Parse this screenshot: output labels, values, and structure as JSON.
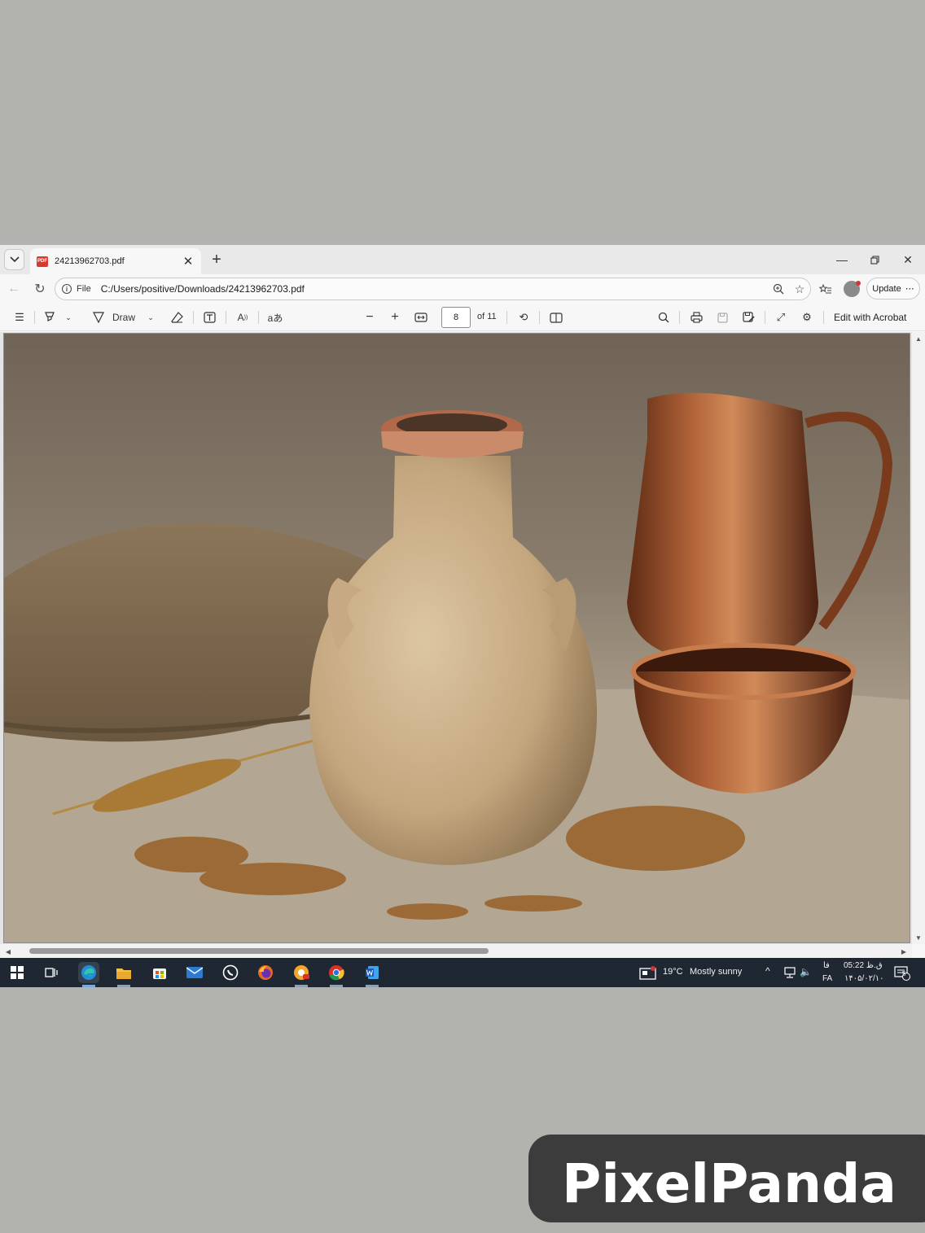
{
  "browser": {
    "tab": {
      "title": "24213962703.pdf"
    },
    "address": {
      "scheme": "File",
      "url": "C:/Users/positive/Downloads/24213962703.pdf"
    },
    "update_label": "Update"
  },
  "pdf_toolbar": {
    "draw_label": "Draw",
    "page_current": "8",
    "page_total": "of 11",
    "edit_acrobat_label": "Edit with Acrobat"
  },
  "document": {
    "image_subject": "still life photo of clay amphora jar, copper pitcher and bowl, wheat ears and grains on burlap"
  },
  "taskbar": {
    "weather_temp": "19°C",
    "weather_text": "Mostly sunny",
    "lang_top": "فا",
    "lang_bottom": "FA",
    "time": "ق.ظ 05:22",
    "date": "۱۴۰۵/۰۲/۱۰",
    "notif_count": "5"
  },
  "watermark": {
    "text": "PixelPanda"
  }
}
